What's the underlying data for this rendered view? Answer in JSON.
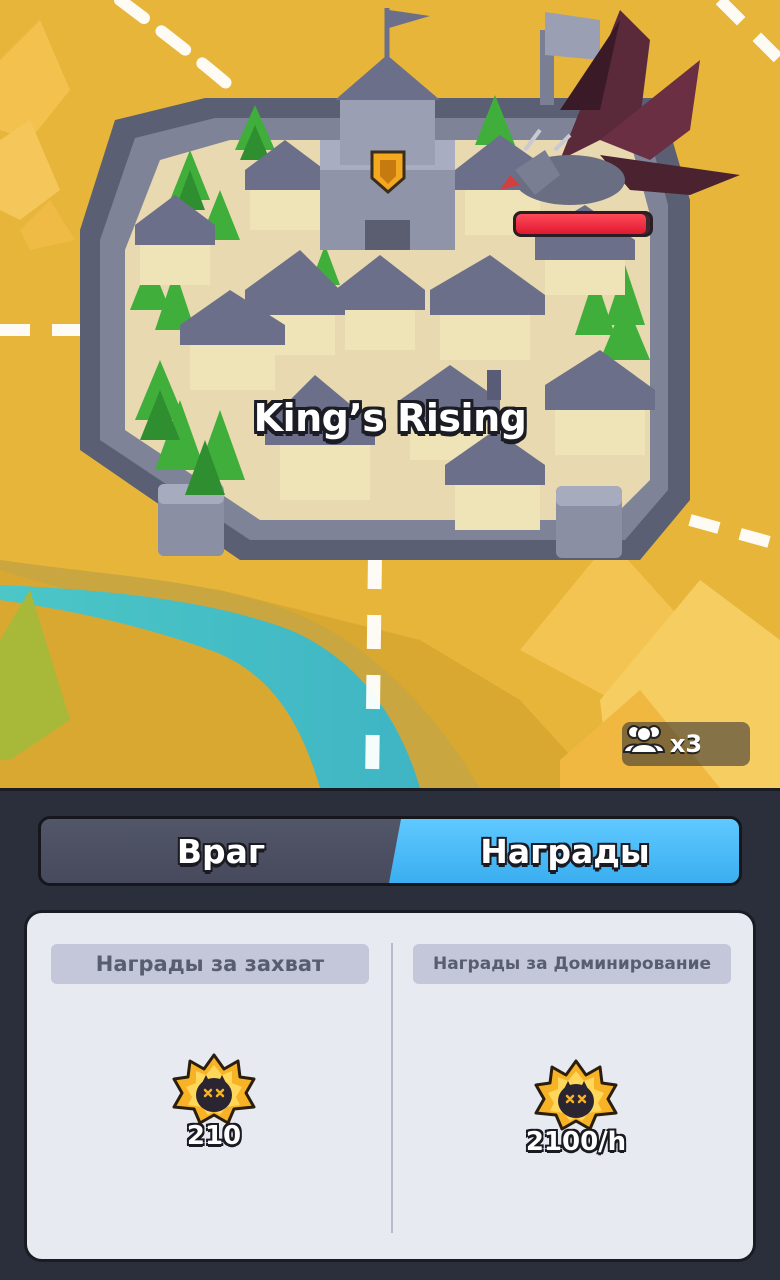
{
  "map": {
    "town_name": "King’s Rising",
    "enemy_health_fraction": 0.97,
    "multiplier_label": "x3"
  },
  "tabs": {
    "enemy_label": "Враг",
    "rewards_label": "Награды",
    "active": "rewards"
  },
  "rewards": {
    "capture": {
      "label": "Награды за захват",
      "icon": "skull-badge-icon",
      "amount": "210"
    },
    "dominance": {
      "label": "Награды за Доминирование",
      "icon": "skull-badge-icon",
      "amount": "2100/h"
    }
  },
  "colors": {
    "map_ground": "#e8b838",
    "active_tab": "#3aaef0",
    "inactive_tab": "#4a4e60",
    "health_bar": "#e01830"
  }
}
